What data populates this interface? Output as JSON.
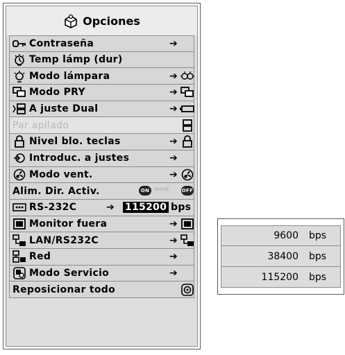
{
  "menu": {
    "title": "Opciones",
    "items": [
      {
        "label": "Contraseña",
        "icon": "key-icon",
        "arrow": "➔",
        "right_icon": ""
      },
      {
        "label": "Temp lámp (dur)",
        "icon": "lamp-timer-icon",
        "arrow": "",
        "right_icon": ""
      },
      {
        "label": "Modo lámpara",
        "icon": "lamp-icon",
        "arrow": "➔",
        "right_icon": "lamp-mode-icon"
      },
      {
        "label": "Modo PRY",
        "icon": "projection-icon",
        "arrow": "➔",
        "right_icon": "projection-icon"
      },
      {
        "label": "A juste Dual",
        "icon": "dual-icon",
        "arrow": "➔",
        "right_icon": "battery-icon"
      },
      {
        "label": "Par apilado",
        "icon": "",
        "arrow": "",
        "right_icon": "stack-icon",
        "disabled": true
      },
      {
        "label": "Nivel blo. teclas",
        "icon": "padlock-icon",
        "arrow": "➔",
        "right_icon": "padlock-icon"
      },
      {
        "label": "Introduc. a justes",
        "icon": "input-icon",
        "arrow": "➔",
        "right_icon": ""
      },
      {
        "label": "Modo vent.",
        "icon": "fan-icon",
        "arrow": "➔",
        "right_icon": "fan-icon"
      },
      {
        "label": "Alim. Dir. Activ.",
        "on_label": "ON",
        "off_label": "OFF"
      },
      {
        "label": "RS-232C",
        "icon": "serial-icon",
        "arrow": "➔",
        "value": "115200",
        "unit": "bps"
      },
      {
        "label": "Monitor fuera",
        "icon": "monitor-icon",
        "arrow": "➔",
        "right_icon": "monitor-icon"
      },
      {
        "label": "LAN/RS232C",
        "icon": "lan-icon",
        "arrow": "➔",
        "right_icon": "lan-icon"
      },
      {
        "label": "Red",
        "icon": "network-icon",
        "arrow": "➔",
        "right_icon": ""
      },
      {
        "label": "Modo Servicio",
        "icon": "service-icon",
        "arrow": "➔",
        "right_icon": ""
      },
      {
        "label": "Reposicionar todo",
        "icon": "",
        "arrow": "",
        "right_icon": "reset-icon"
      }
    ]
  },
  "submenu": {
    "options": [
      {
        "value": "9600",
        "unit": "bps"
      },
      {
        "value": "38400",
        "unit": "bps"
      },
      {
        "value": "115200",
        "unit": "bps"
      }
    ]
  }
}
